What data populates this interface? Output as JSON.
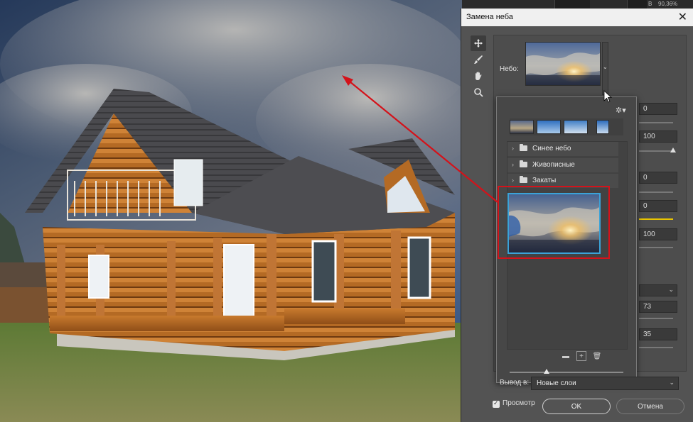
{
  "dialog": {
    "title": "Замена неба",
    "close": "✕",
    "sky_label": "Небо:",
    "output_label": "Вывод в:",
    "output_value": "Новые слои",
    "preview_label": "Просмотр",
    "ok_label": "OK",
    "cancel_label": "Отмена"
  },
  "app": {
    "zoom_prefix": "В",
    "zoom_value": "90,36%"
  },
  "fields": [
    "0",
    "100",
    "0",
    "0",
    "100",
    "73",
    "35"
  ],
  "presets": {
    "folders": [
      {
        "label": "Синее небо"
      },
      {
        "label": "Живописные"
      },
      {
        "label": "Закаты"
      }
    ]
  },
  "tools": [
    "move-icon",
    "brush-icon",
    "hand-icon",
    "zoom-icon"
  ],
  "colors": {
    "highlight": "#d4121a",
    "selection": "#3ba3d8",
    "accent_slider": "#e8c400"
  }
}
